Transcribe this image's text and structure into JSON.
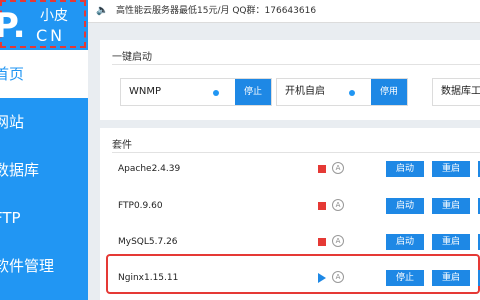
{
  "logo": {
    "mark": "P.",
    "text_top": "小皮",
    "text_bottom": "CN"
  },
  "sidebar": {
    "items": [
      {
        "label": "首页"
      },
      {
        "label": "网站"
      },
      {
        "label": "数据库"
      },
      {
        "label": "FTP"
      },
      {
        "label": "软件管理"
      }
    ]
  },
  "topbar": {
    "speaker_icon": "speaker-icon",
    "ad": "高性能云服务器最低15元/月  QQ群：176643616"
  },
  "quickstart": {
    "title": "一键启动",
    "wnmp": {
      "label": "WNMP",
      "button": "停止"
    },
    "autostart": {
      "label": "开机自启",
      "button": "停用"
    },
    "dbtool": {
      "label": "数据库工"
    }
  },
  "suite": {
    "title": "套件",
    "rows": [
      {
        "name": "Apache2.4.39",
        "status": "stopped",
        "start": "启动",
        "restart": "重启"
      },
      {
        "name": "FTP0.9.60",
        "status": "stopped",
        "start": "启动",
        "restart": "重启"
      },
      {
        "name": "MySQL5.7.26",
        "status": "stopped",
        "start": "启动",
        "restart": "重启"
      },
      {
        "name": "Nginx1.15.11",
        "status": "running",
        "start": "停止",
        "restart": "重启"
      }
    ],
    "auto_icon_glyph": "A"
  },
  "colors": {
    "accent": "#2196f3",
    "button": "#1e88e5",
    "stopped": "#e53935",
    "highlight": "#e53935"
  }
}
